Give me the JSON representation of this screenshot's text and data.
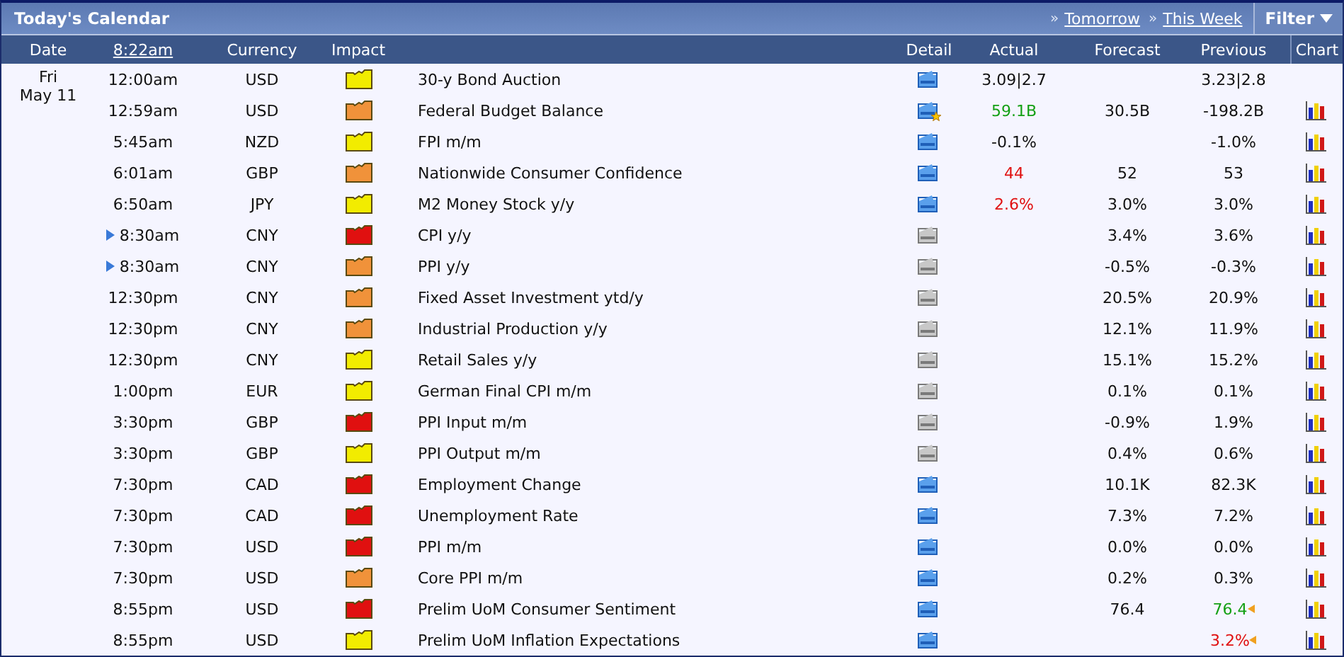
{
  "title": "Today's Calendar",
  "nav_links": [
    {
      "marker": "»",
      "label": "Tomorrow"
    },
    {
      "marker": "»",
      "label": "This Week"
    }
  ],
  "filter": {
    "label": "Filter"
  },
  "columns": [
    {
      "label": "Date",
      "link": false
    },
    {
      "label": "8:22am",
      "link": true
    },
    {
      "label": "Currency",
      "link": false
    },
    {
      "label": "Impact",
      "link": false
    },
    {
      "label": "Detail",
      "link": false
    },
    {
      "label": "Actual",
      "link": false
    },
    {
      "label": "Forecast",
      "link": false
    },
    {
      "label": "Previous",
      "link": false
    },
    {
      "label": "Chart",
      "link": false
    }
  ],
  "date": {
    "day": "Fri",
    "date": "May 11"
  },
  "rows": [
    {
      "time": "12:00am",
      "upcoming": false,
      "currency": "USD",
      "impact": {
        "color": "#f2ec00"
      },
      "event": "30-y Bond Auction",
      "detail": {
        "kind": "active"
      },
      "actual": {
        "text": "3.09|2.7",
        "color": "#111111"
      },
      "previous": {
        "text": "3.23|2.8",
        "color": "#111111"
      },
      "revised": false,
      "chart": false
    },
    {
      "time": "12:59am",
      "upcoming": false,
      "currency": "USD",
      "impact": {
        "color": "#f0923a"
      },
      "event": "Federal Budget Balance",
      "detail": {
        "kind": "starred"
      },
      "actual": {
        "text": "59.1B",
        "color": "#14a014"
      },
      "forecast": "30.5B",
      "previous": {
        "text": "-198.2B",
        "color": "#111111"
      },
      "revised": false,
      "chart": true
    },
    {
      "time": "5:45am",
      "upcoming": false,
      "currency": "NZD",
      "impact": {
        "color": "#f2ec00"
      },
      "event": "FPI m/m",
      "detail": {
        "kind": "active"
      },
      "actual": {
        "text": "-0.1%",
        "color": "#111111"
      },
      "previous": {
        "text": "-1.0%",
        "color": "#111111"
      },
      "revised": false,
      "chart": true
    },
    {
      "time": "6:01am",
      "upcoming": false,
      "currency": "GBP",
      "impact": {
        "color": "#f0923a"
      },
      "event": "Nationwide Consumer Confidence",
      "detail": {
        "kind": "active"
      },
      "actual": {
        "text": "44",
        "color": "#e01010"
      },
      "forecast": "52",
      "previous": {
        "text": "53",
        "color": "#111111"
      },
      "revised": false,
      "chart": true
    },
    {
      "time": "6:50am",
      "upcoming": false,
      "currency": "JPY",
      "impact": {
        "color": "#f2ec00"
      },
      "event": "M2 Money Stock y/y",
      "detail": {
        "kind": "active"
      },
      "actual": {
        "text": "2.6%",
        "color": "#e01010"
      },
      "forecast": "3.0%",
      "previous": {
        "text": "3.0%",
        "color": "#111111"
      },
      "revised": false,
      "chart": true
    },
    {
      "time": "8:30am",
      "upcoming": true,
      "currency": "CNY",
      "impact": {
        "color": "#e01010"
      },
      "event": "CPI y/y",
      "detail": {
        "kind": "inactive"
      },
      "forecast": "3.4%",
      "previous": {
        "text": "3.6%",
        "color": "#111111"
      },
      "revised": false,
      "chart": true
    },
    {
      "time": "8:30am",
      "upcoming": true,
      "currency": "CNY",
      "impact": {
        "color": "#f0923a"
      },
      "event": "PPI y/y",
      "detail": {
        "kind": "inactive"
      },
      "forecast": "-0.5%",
      "previous": {
        "text": "-0.3%",
        "color": "#111111"
      },
      "revised": false,
      "chart": true
    },
    {
      "time": "12:30pm",
      "upcoming": false,
      "currency": "CNY",
      "impact": {
        "color": "#f0923a"
      },
      "event": "Fixed Asset Investment ytd/y",
      "detail": {
        "kind": "inactive"
      },
      "forecast": "20.5%",
      "previous": {
        "text": "20.9%",
        "color": "#111111"
      },
      "revised": false,
      "chart": true
    },
    {
      "time": "12:30pm",
      "upcoming": false,
      "currency": "CNY",
      "impact": {
        "color": "#f0923a"
      },
      "event": "Industrial Production y/y",
      "detail": {
        "kind": "inactive"
      },
      "forecast": "12.1%",
      "previous": {
        "text": "11.9%",
        "color": "#111111"
      },
      "revised": false,
      "chart": true
    },
    {
      "time": "12:30pm",
      "upcoming": false,
      "currency": "CNY",
      "impact": {
        "color": "#f2ec00"
      },
      "event": "Retail Sales y/y",
      "detail": {
        "kind": "inactive"
      },
      "forecast": "15.1%",
      "previous": {
        "text": "15.2%",
        "color": "#111111"
      },
      "revised": false,
      "chart": true
    },
    {
      "time": "1:00pm",
      "upcoming": false,
      "currency": "EUR",
      "impact": {
        "color": "#f2ec00"
      },
      "event": "German Final CPI m/m",
      "detail": {
        "kind": "inactive"
      },
      "forecast": "0.1%",
      "previous": {
        "text": "0.1%",
        "color": "#111111"
      },
      "revised": false,
      "chart": true
    },
    {
      "time": "3:30pm",
      "upcoming": false,
      "currency": "GBP",
      "impact": {
        "color": "#e01010"
      },
      "event": "PPI Input m/m",
      "detail": {
        "kind": "inactive"
      },
      "forecast": "-0.9%",
      "previous": {
        "text": "1.9%",
        "color": "#111111"
      },
      "revised": false,
      "chart": true
    },
    {
      "time": "3:30pm",
      "upcoming": false,
      "currency": "GBP",
      "impact": {
        "color": "#f2ec00"
      },
      "event": "PPI Output m/m",
      "detail": {
        "kind": "inactive"
      },
      "forecast": "0.4%",
      "previous": {
        "text": "0.6%",
        "color": "#111111"
      },
      "revised": false,
      "chart": true
    },
    {
      "time": "7:30pm",
      "upcoming": false,
      "currency": "CAD",
      "impact": {
        "color": "#e01010"
      },
      "event": "Employment Change",
      "detail": {
        "kind": "active"
      },
      "forecast": "10.1K",
      "previous": {
        "text": "82.3K",
        "color": "#111111"
      },
      "revised": false,
      "chart": true
    },
    {
      "time": "7:30pm",
      "upcoming": false,
      "currency": "CAD",
      "impact": {
        "color": "#e01010"
      },
      "event": "Unemployment Rate",
      "detail": {
        "kind": "active"
      },
      "forecast": "7.3%",
      "previous": {
        "text": "7.2%",
        "color": "#111111"
      },
      "revised": false,
      "chart": true
    },
    {
      "time": "7:30pm",
      "upcoming": false,
      "currency": "USD",
      "impact": {
        "color": "#e01010"
      },
      "event": "PPI m/m",
      "detail": {
        "kind": "active"
      },
      "forecast": "0.0%",
      "previous": {
        "text": "0.0%",
        "color": "#111111"
      },
      "revised": false,
      "chart": true
    },
    {
      "time": "7:30pm",
      "upcoming": false,
      "currency": "USD",
      "impact": {
        "color": "#f0923a"
      },
      "event": "Core PPI m/m",
      "detail": {
        "kind": "active"
      },
      "forecast": "0.2%",
      "previous": {
        "text": "0.3%",
        "color": "#111111"
      },
      "revised": false,
      "chart": true
    },
    {
      "time": "8:55pm",
      "upcoming": false,
      "currency": "USD",
      "impact": {
        "color": "#e01010"
      },
      "event": "Prelim UoM Consumer Sentiment",
      "detail": {
        "kind": "active"
      },
      "forecast": "76.4",
      "previous": {
        "text": "76.4",
        "color": "#14a014"
      },
      "revised": true,
      "chart": true
    },
    {
      "time": "8:55pm",
      "upcoming": false,
      "currency": "USD",
      "impact": {
        "color": "#f2ec00"
      },
      "event": "Prelim UoM Inflation Expectations",
      "detail": {
        "kind": "active"
      },
      "previous": {
        "text": "3.2%",
        "color": "#e01010"
      },
      "revised": true,
      "chart": true
    }
  ]
}
